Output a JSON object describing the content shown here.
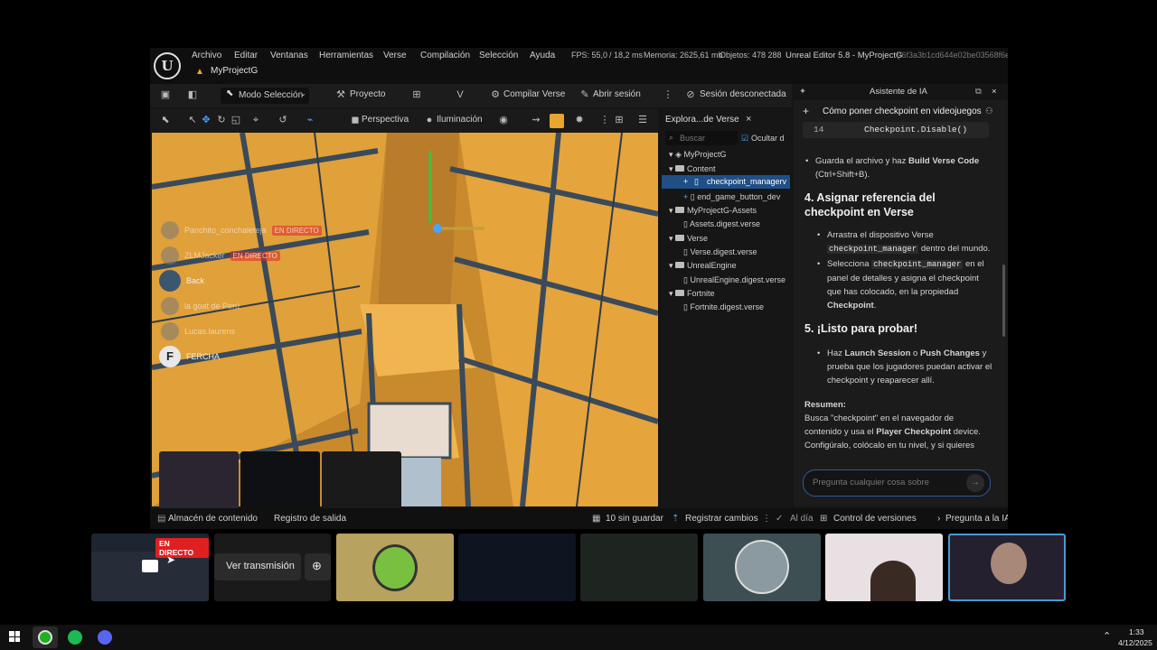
{
  "menubar": {
    "logo": "U",
    "menus": [
      "Archivo",
      "Editar",
      "Ventanas",
      "Herramientas",
      "Verse",
      "Compilación",
      "Selección",
      "Ayuda"
    ],
    "fps_label": "FPS: 55,0",
    "ms_label": "/ 18,2 ms",
    "memory_label": "Memoria: 2625,61 mb",
    "objects_label": "Objetos: 478 288",
    "title": "Unreal Editor 5.8 - MyProjectG",
    "session_id": "(f6f3a3b1cd644e02be03568f6e",
    "project_tab": "MyProjectG"
  },
  "toolbar": {
    "mode": "Modo Selección",
    "project": "Proyecto",
    "compile": "Compilar Verse",
    "open_file": "Abrir sesión",
    "session": "Sesión desconectada"
  },
  "viewport_toolbar": {
    "perspective": "Perspectiva",
    "lighting": "Iluminación"
  },
  "outliner": {
    "tab": "Explora...de Verse",
    "search_placeholder": "Buscar",
    "hide_label": "Ocultar d",
    "items": [
      {
        "label": "MyProjectG"
      },
      {
        "label": "Content"
      },
      {
        "label": "checkpoint_managerv"
      },
      {
        "label": "end_game_button_dev"
      },
      {
        "label": "MyProjectG-Assets"
      },
      {
        "label": "Assets.digest.verse"
      },
      {
        "label": "Verse"
      },
      {
        "label": "Verse.digest.verse"
      },
      {
        "label": "UnrealEngine"
      },
      {
        "label": "UnrealEngine.digest.verse"
      },
      {
        "label": "Fortnite"
      },
      {
        "label": "Fortnite.digest.verse"
      }
    ]
  },
  "ai_panel": {
    "title": "Asistente de IA",
    "conversation": "Cómo poner checkpoint en videojuegos",
    "code_line_no": "14",
    "code_line": "Checkpoint.Disable()",
    "bullet_save_a": "Guarda el archivo y haz ",
    "bullet_save_b": "Build Verse Code",
    "bullet_save_c": "(Ctrl+Shift+B).",
    "h4": "4. Asignar referencia del checkpoint en Verse",
    "b1_a": "Arrastra el dispositivo Verse",
    "b1_code": "checkpoint_manager",
    "b1_b": " dentro del mundo.",
    "b2_a": "Selecciona ",
    "b2_code": "checkpoint_manager",
    "b2_b": " en el panel de detalles y asigna el checkpoint que has colocado, en la propiedad ",
    "b2_bold": "Checkpoint",
    "b2_end": ".",
    "h5": "5. ¡Listo para probar!",
    "b3_a": "Haz ",
    "b3_b1": "Launch Session",
    "b3_c": " o ",
    "b3_b2": "Push Changes",
    "b3_d": " y prueba que los jugadores puedan activar el checkpoint y reaparecer allí.",
    "summary_title": "Resumen:",
    "summary_a": "Busca \"checkpoint\" en el navegador de contenido y usa el ",
    "summary_bold": "Player Checkpoint",
    "summary_b": " device. Configúralo, colócalo en tu nivel, y si quieres",
    "input_placeholder": "Pregunta cualquier cosa sobre"
  },
  "statusbar": {
    "content_drawer": "Almacén de contenido",
    "output_log": "Registro de salida",
    "unsaved": "10 sin guardar",
    "track_changes": "Registrar cambios",
    "up_to_date": "Al día",
    "version_control": "Control de versiones",
    "ask_ai": "Pregunta a la IA"
  },
  "stream_chat": [
    {
      "name": "Panchito_conchaleteja",
      "badge": "EN DIRECTO"
    },
    {
      "name": "ZLMJacker",
      "badge": "EN DIRECTO"
    },
    {
      "name": "Back",
      "badge": ""
    },
    {
      "name": "la goat de Perú",
      "badge": ""
    },
    {
      "name": "Lucas.laurens",
      "badge": ""
    },
    {
      "name": "FERCHA",
      "badge": ""
    }
  ],
  "stream_bar": {
    "live_badge": "EN DIRECTO",
    "watch_label": "Ver transmisión"
  },
  "taskbar": {
    "time": "1:33",
    "date": "4/12/2025"
  }
}
